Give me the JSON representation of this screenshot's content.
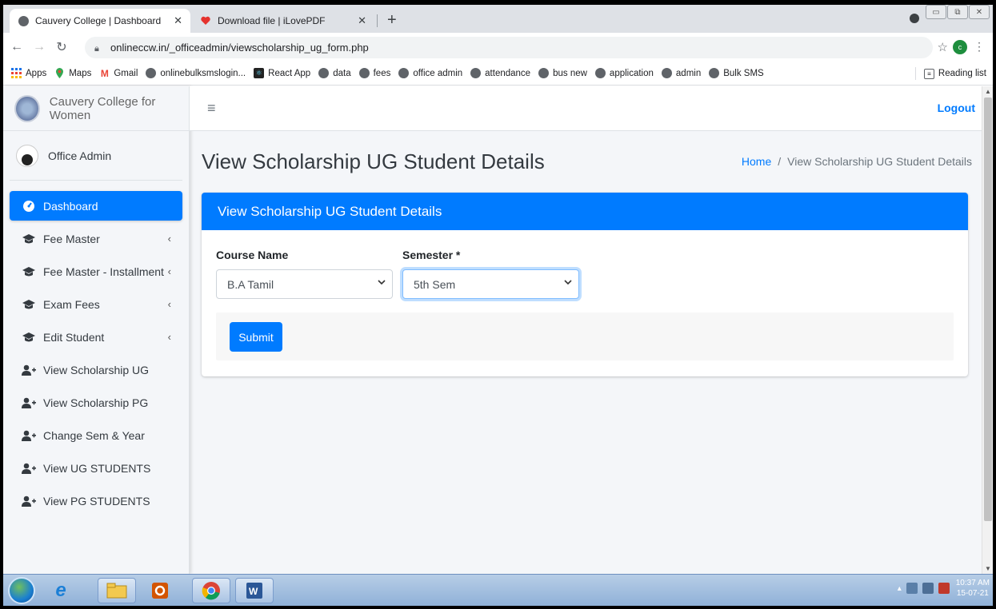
{
  "browser": {
    "tabs": [
      {
        "title": "Cauvery College | Dashboard",
        "active": true
      },
      {
        "title": "Download file | iLovePDF",
        "active": false
      }
    ],
    "url": "onlineccw.in/_officeadmin/viewscholarship_ug_form.php",
    "profile_initial": "c",
    "bookmarks": [
      {
        "label": "Apps",
        "icon": "apps-grid-icon"
      },
      {
        "label": "Maps",
        "icon": "maps-icon"
      },
      {
        "label": "Gmail",
        "icon": "gmail-icon"
      },
      {
        "label": "onlinebulksmslogin...",
        "icon": "globe-icon"
      },
      {
        "label": "React App",
        "icon": "react-icon"
      },
      {
        "label": "data",
        "icon": "globe-icon"
      },
      {
        "label": "fees",
        "icon": "globe-icon"
      },
      {
        "label": "office admin",
        "icon": "globe-icon"
      },
      {
        "label": "attendance",
        "icon": "globe-icon"
      },
      {
        "label": "bus new",
        "icon": "globe-icon"
      },
      {
        "label": "application",
        "icon": "globe-icon"
      },
      {
        "label": "admin",
        "icon": "globe-icon"
      },
      {
        "label": "Bulk SMS",
        "icon": "globe-icon"
      }
    ],
    "reading_list": "Reading list"
  },
  "sidebar": {
    "brand": "Cauvery College for Women",
    "user": "Office Admin",
    "items": [
      {
        "label": "Dashboard",
        "icon": "dashboard-icon",
        "active": true,
        "caret": false
      },
      {
        "label": "Fee Master",
        "icon": "graduation-cap-icon",
        "active": false,
        "caret": true
      },
      {
        "label": "Fee Master - Installment",
        "icon": "graduation-cap-icon",
        "active": false,
        "caret": true
      },
      {
        "label": "Exam Fees",
        "icon": "graduation-cap-icon",
        "active": false,
        "caret": true
      },
      {
        "label": "Edit Student",
        "icon": "graduation-cap-icon",
        "active": false,
        "caret": true
      },
      {
        "label": "View Scholarship UG",
        "icon": "user-plus-icon",
        "active": false,
        "caret": false
      },
      {
        "label": "View Scholarship PG",
        "icon": "user-plus-icon",
        "active": false,
        "caret": false
      },
      {
        "label": "Change Sem & Year",
        "icon": "user-plus-icon",
        "active": false,
        "caret": false
      },
      {
        "label": "View UG STUDENTS",
        "icon": "user-plus-icon",
        "active": false,
        "caret": false
      },
      {
        "label": "View PG STUDENTS",
        "icon": "user-plus-icon",
        "active": false,
        "caret": false
      }
    ]
  },
  "header": {
    "logout": "Logout",
    "page_title": "View Scholarship UG Student Details",
    "breadcrumb": {
      "home": "Home",
      "separator": "/",
      "current": "View Scholarship UG Student Details"
    }
  },
  "form": {
    "card_title": "View Scholarship UG Student Details",
    "course": {
      "label": "Course Name",
      "value": "B.A Tamil"
    },
    "semester": {
      "label": "Semester *",
      "value": "5th Sem"
    },
    "submit": "Submit"
  },
  "taskbar": {
    "time": "10:37 AM",
    "date": "15-07-21"
  },
  "colors": {
    "primary": "#007bff",
    "sidebar_bg": "#f4f6f9"
  }
}
